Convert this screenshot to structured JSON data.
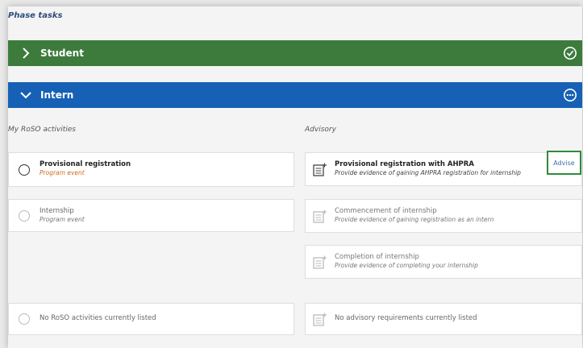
{
  "phase": {
    "title": "Phase tasks"
  },
  "sections": {
    "student": {
      "label": "Student",
      "color": "#3c7b3c",
      "status": "completed"
    },
    "intern": {
      "label": "Intern",
      "color": "#1661b5",
      "status": "in-progress"
    }
  },
  "roso": {
    "heading": "My RoSO activities",
    "items": [
      {
        "name": "Provisional registration",
        "type": "Program event"
      },
      {
        "name": "Internship",
        "type": "Program event"
      }
    ],
    "empty": "No RoSO activities currently listed"
  },
  "advisory": {
    "heading": "Advisory",
    "items": [
      {
        "name": "Provisional registration with AHPRA",
        "desc": "Provide evidence of gaining AHPRA registration for internship",
        "action": "Advise"
      },
      {
        "name": "Commencement of internship",
        "desc": "Provide evidence of gaining registration as an intern"
      },
      {
        "name": "Completion of internship",
        "desc": "Provide evidence of completing your internship"
      }
    ],
    "empty": "No advisory requirements currently listed"
  },
  "icons": {
    "expand": "chevron-right-icon",
    "collapse": "chevron-down-icon",
    "completed": "check-circle-icon",
    "in_progress": "more-circle-icon",
    "document": "document-add-icon"
  }
}
